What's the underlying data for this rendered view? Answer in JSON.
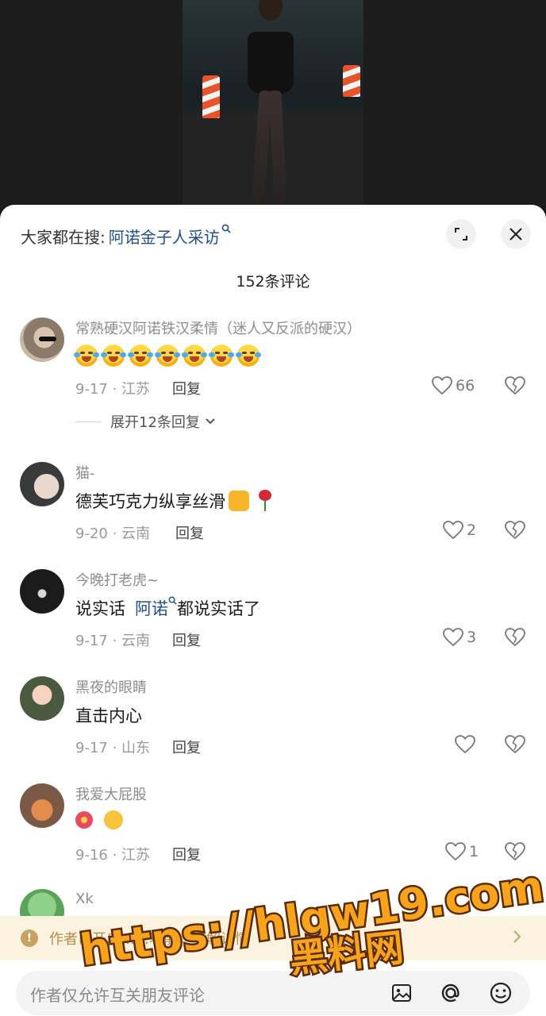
{
  "search": {
    "prefix": "大家都在搜:",
    "term": "阿诺金子人采访",
    "glyph": "⚲"
  },
  "comment_count": "152条评论",
  "comments": [
    {
      "name": "常熟硬汉阿诺铁汉柔情（迷人又反派的硬汉）",
      "date": "9-17 · 江苏",
      "reply": "回复",
      "likes": "66",
      "expand": "展开12条回复"
    },
    {
      "name": "猫-",
      "text": "德芙巧克力纵享丝滑",
      "date": "9-20 · 云南",
      "reply": "回复",
      "likes": "2"
    },
    {
      "name": "今晚打老虎~",
      "text_before": "说实话",
      "mention": "阿诺",
      "text_after": "都说实话了",
      "date": "9-17 · 云南",
      "reply": "回复",
      "likes": "3"
    },
    {
      "name": "黑夜的眼睛",
      "text": "直击内心",
      "date": "9-17 · 山东",
      "reply": "回复",
      "likes": ""
    },
    {
      "name": "我爱大屁股",
      "date": "9-16 · 江苏",
      "reply": "回复",
      "likes": "1"
    },
    {
      "name": "Xk"
    }
  ],
  "notice": {
    "text": "作者已开启……功能，了解详情"
  },
  "input": {
    "placeholder": "作者仅允许互关朋友评论"
  },
  "watermark": {
    "line1": "https://hlgw19.com",
    "line2": "黑料网"
  },
  "colors": {
    "accent_link": "#1f4e8c",
    "notice_bg": "#fbf3df",
    "watermark_fill": "#f7a41c"
  }
}
